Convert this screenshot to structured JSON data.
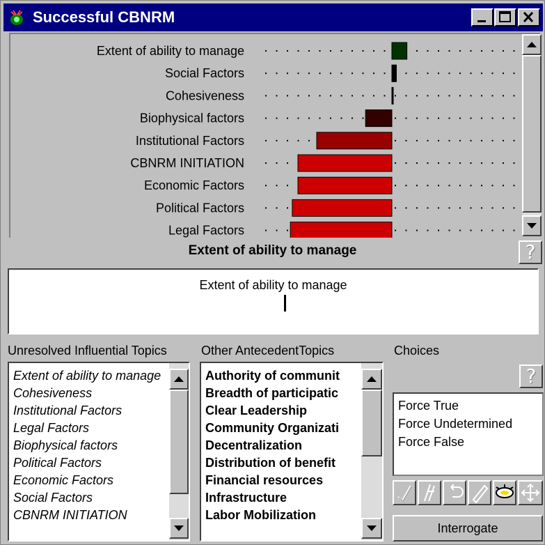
{
  "window": {
    "title": "Successful CBNRM"
  },
  "chart": {
    "factors": [
      {
        "label": "Extent of ability to manage",
        "value": 0.04,
        "color": "#003300"
      },
      {
        "label": "Social Factors",
        "value": 0.012,
        "color": "#000000"
      },
      {
        "label": "Cohesiveness",
        "value": 0.0,
        "color": "#000000"
      },
      {
        "label": "Biophysical factors",
        "value": -0.07,
        "color": "#330000"
      },
      {
        "label": "Institutional Factors",
        "value": -0.2,
        "color": "#990000"
      },
      {
        "label": "CBNRM INITIATION",
        "value": -0.25,
        "color": "#cc0000"
      },
      {
        "label": "Economic Factors",
        "value": -0.25,
        "color": "#cc0000"
      },
      {
        "label": "Political Factors",
        "value": -0.265,
        "color": "#cc0000"
      },
      {
        "label": "Legal Factors",
        "value": -0.27,
        "color": "#cc0000"
      }
    ]
  },
  "selected_topic": {
    "header": "Extent of ability to manage",
    "detail_title": "Extent of ability to manage"
  },
  "panels": {
    "unresolved_label": "Unresolved Influential Topics",
    "antecedent_label": "Other AntecedentTopics",
    "choices_label": "Choices"
  },
  "unresolved_topics": [
    "Extent of ability to manage",
    "Cohesiveness",
    "Institutional Factors",
    "Legal Factors",
    "Biophysical factors",
    "Political Factors",
    "Economic Factors",
    "Social Factors",
    "CBNRM INITIATION"
  ],
  "antecedent_topics": [
    "Authority of communit",
    "Breadth of participatic",
    "Clear Leadership",
    "Community Organizati",
    "Decentralization",
    "Distribution of benefit",
    "Financial resources",
    "Infrastructure",
    "Labor Mobilization"
  ],
  "choices": [
    "Force True",
    "Force Undetermined",
    "Force False"
  ],
  "buttons": {
    "help": "?",
    "interrogate": "Interrogate"
  }
}
